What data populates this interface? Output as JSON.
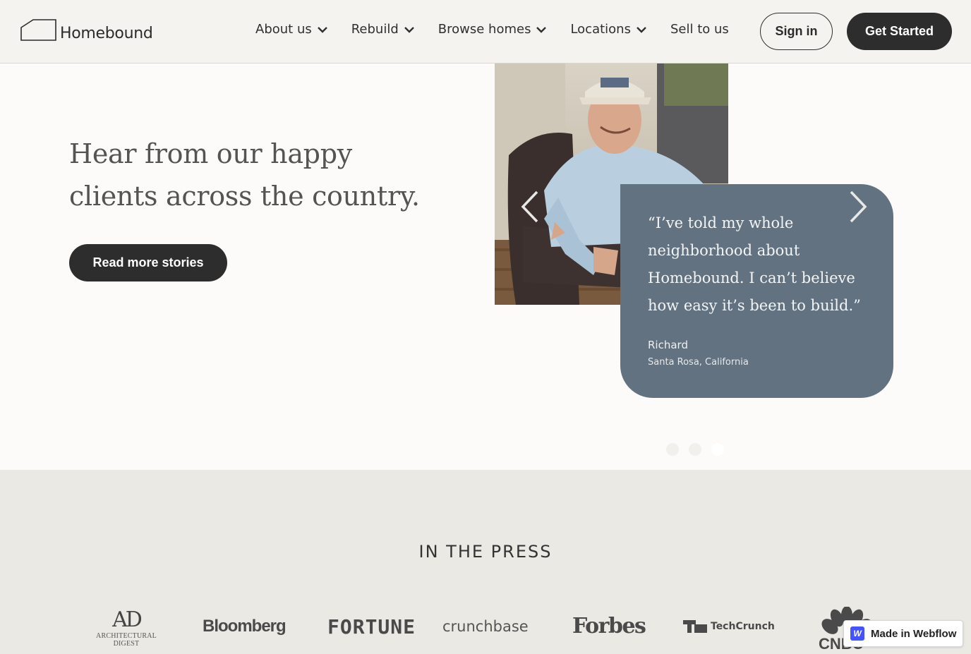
{
  "header": {
    "brand": "Homebound",
    "nav": [
      {
        "label": "About us",
        "has_dropdown": true
      },
      {
        "label": "Rebuild",
        "has_dropdown": true
      },
      {
        "label": "Browse homes",
        "has_dropdown": true
      },
      {
        "label": "Locations",
        "has_dropdown": true
      },
      {
        "label": "Sell to us",
        "has_dropdown": false
      }
    ],
    "signin_label": "Sign in",
    "get_started_label": "Get Started"
  },
  "testimonials": {
    "heading_line1": "Hear from our happy",
    "heading_line2": "clients across the country.",
    "read_more_label": "Read more stories",
    "quote": "“I’ve told my whole neighborhood about Homebound. I can’t believe how easy it’s been to build.”",
    "name": "Richard",
    "location": "Santa Rosa, California",
    "slides_total": 3,
    "active_slide": 3
  },
  "press": {
    "title": "IN THE PRESS",
    "logos": {
      "ad_mark": "AD",
      "ad_sub": "ARCHITECTURAL DIGEST",
      "bloomberg": "Bloomberg",
      "fortune": "FORTUNE",
      "crunchbase": "crunchbase",
      "forbes": "Forbes",
      "techcrunch": "TechCrunch",
      "cnbc": "CNBC"
    }
  },
  "webflow_badge": {
    "icon_letter": "W",
    "label": "Made in Webflow"
  },
  "colors": {
    "header_bg": "#f4f3ef",
    "dark_button": "#2d2d2d",
    "quote_card": "#627280",
    "press_bg": "#ebe9e4",
    "webflow_blue": "#4353ff"
  }
}
